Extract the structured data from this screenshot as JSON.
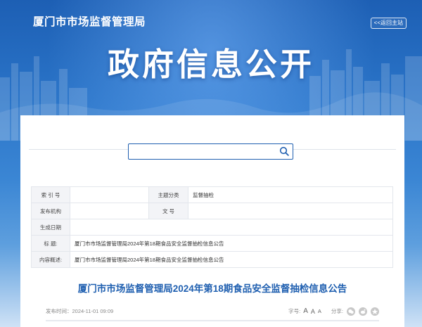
{
  "header": {
    "site_title": "厦门市市场监督管理局",
    "home_link": "<<返回主站",
    "banner_title": "政府信息公开"
  },
  "search": {
    "placeholder": "",
    "value": ""
  },
  "info": {
    "index_label": "索 引 号",
    "index_value": "",
    "category_label": "主题分类",
    "category_value": "监督抽检",
    "publisher_label": "发布机构",
    "publisher_value": "",
    "docno_label": "文  号",
    "docno_value": "",
    "date_label": "生成日期",
    "date_value": "",
    "title_label": "标  题:",
    "title_value": "厦门市市场监督管理局2024年第18期食品安全监督抽检信息公告",
    "summary_label": "内容概述:",
    "summary_value": "厦门市市场监督管理局2024年第18期食品安全监督抽检信息公告"
  },
  "article": {
    "title": "厦门市市场监督管理局2024年第18期食品安全监督抽检信息公告",
    "publish_time": "发布时间：2024-11-01 09:09",
    "font_size_label": "字号:",
    "font_large": "A",
    "font_medium": "A",
    "font_small": "A",
    "share_label": "分享:"
  },
  "colors": {
    "brand_blue": "#1f5fb0",
    "header_blue": "#1d5fb4"
  }
}
